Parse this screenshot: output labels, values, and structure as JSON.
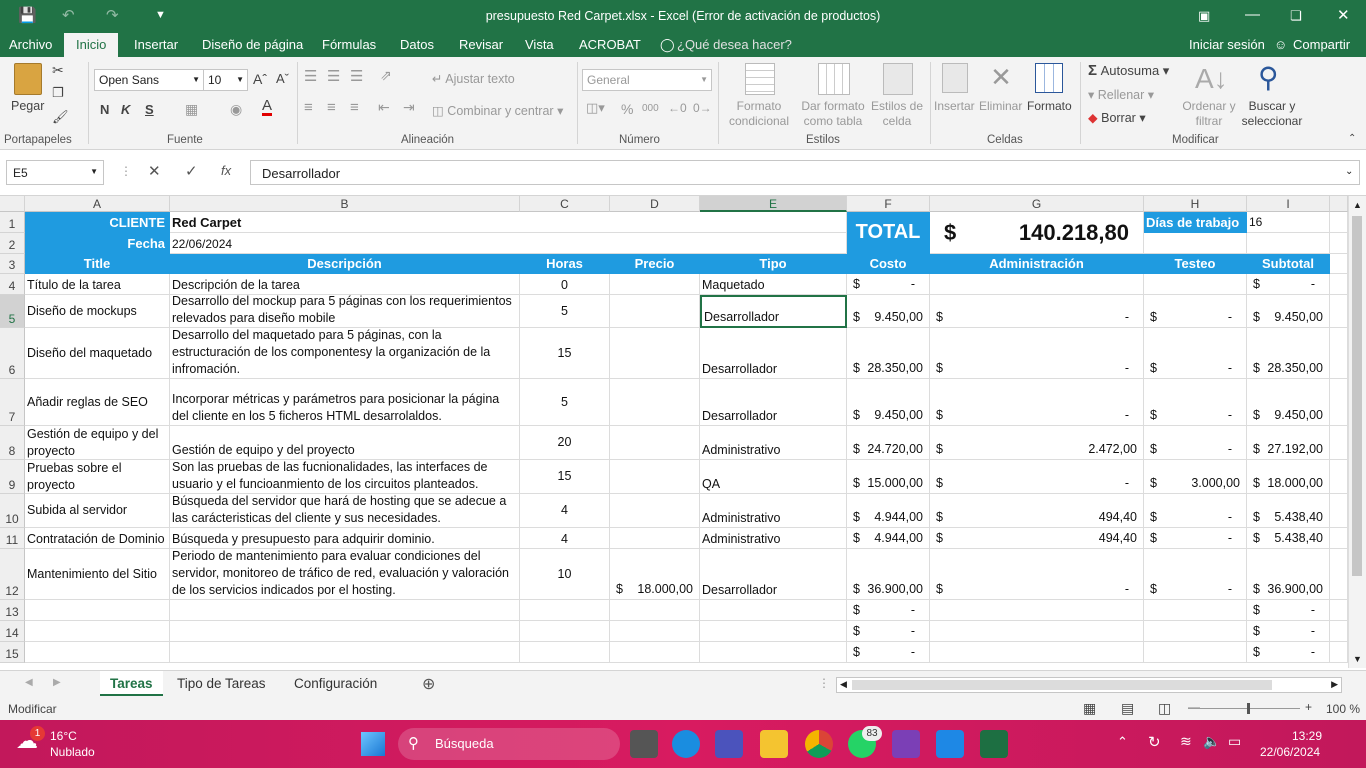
{
  "window": {
    "title": "presupuesto Red Carpet.xlsx - Excel (Error de activación de productos)"
  },
  "menu": {
    "file": "Archivo",
    "tabs": [
      "Inicio",
      "Insertar",
      "Diseño de página",
      "Fórmulas",
      "Datos",
      "Revisar",
      "Vista",
      "ACROBAT"
    ],
    "help": "¿Qué desea hacer?",
    "signin": "Iniciar sesión",
    "share": "Compartir"
  },
  "ribbon": {
    "paste": "Pegar",
    "clipboard": "Portapapeles",
    "font_name": "Open Sans",
    "font_size": "10",
    "font_group": "Fuente",
    "bold": "N",
    "italic": "K",
    "underline": "S",
    "wrap": "Ajustar texto",
    "merge": "Combinar y centrar",
    "align_group": "Alineación",
    "number_format": "General",
    "number_group": "Número",
    "percent": "%",
    "thousands": "000",
    "cond_format": "Formato condicional",
    "as_table": "Dar formato como tabla",
    "cell_styles": "Estilos de celda",
    "styles_group": "Estilos",
    "insert": "Insertar",
    "delete": "Eliminar",
    "format": "Formato",
    "cells_group": "Celdas",
    "autosum": "Autosuma",
    "fill": "Rellenar",
    "clear": "Borrar",
    "sort": "Ordenar y filtrar",
    "find": "Buscar y seleccionar",
    "modify_group": "Modificar"
  },
  "formula_bar": {
    "name_box": "E5",
    "fx": "fx",
    "content": "Desarrollador"
  },
  "columns": [
    "A",
    "B",
    "C",
    "D",
    "E",
    "F",
    "G",
    "H",
    "I"
  ],
  "header": {
    "cliente_label": "CLIENTE",
    "cliente_value": "Red Carpet",
    "fecha_label": "Fecha",
    "fecha_value": "22/06/2024",
    "total_label": "TOTAL",
    "total_currency": "$",
    "total_value": "140.218,80",
    "dias_label": "Días de trabajo",
    "dias_value": "16"
  },
  "table_headers": [
    "Title",
    "Descripción",
    "Horas",
    "Precio",
    "Tipo",
    "Costo",
    "Administración",
    "Testeo",
    "Subtotal"
  ],
  "rows": [
    {
      "n": "4",
      "title": "Título de la tarea",
      "desc": "Descripción de la tarea",
      "horas": "0",
      "precio": "",
      "tipo": "Maquetado",
      "costo": "-",
      "admin": "",
      "testeo": "",
      "subtotal": "-"
    },
    {
      "n": "5",
      "title": "Diseño de mockups",
      "desc": "Desarrollo del mockup para 5 páginas con los requerimientos relevados para diseño mobile",
      "horas": "5",
      "precio": "",
      "tipo": "Desarrollador",
      "costo": "9.450,00",
      "admin": "-",
      "testeo": "-",
      "subtotal": "9.450,00"
    },
    {
      "n": "6",
      "title": "Diseño del maquetado",
      "desc": "Desarrollo del maquetado para 5 páginas, con la estructuración de los componentesy la organización de la infromación.",
      "horas": "15",
      "precio": "",
      "tipo": "Desarrollador",
      "costo": "28.350,00",
      "admin": "-",
      "testeo": "-",
      "subtotal": "28.350,00"
    },
    {
      "n": "7",
      "title": "Añadir reglas de SEO",
      "desc": "Incorporar métricas y parámetros para posicionar la página del cliente en los 5 ficheros HTML desarrolaldos.",
      "horas": "5",
      "precio": "",
      "tipo": "Desarrollador",
      "costo": "9.450,00",
      "admin": "-",
      "testeo": "-",
      "subtotal": "9.450,00"
    },
    {
      "n": "8",
      "title": "Gestión de equipo y del proyecto",
      "desc": "Gestión de equipo y del proyecto",
      "horas": "20",
      "precio": "",
      "tipo": "Administrativo",
      "costo": "24.720,00",
      "admin": "2.472,00",
      "testeo": "-",
      "subtotal": "27.192,00"
    },
    {
      "n": "9",
      "title": "Pruebas sobre el proyecto",
      "desc": "Son las pruebas de las fucnionalidades, las interfaces de usuario y el funcioanmiento de los circuitos planteados.",
      "horas": "15",
      "precio": "",
      "tipo": "QA",
      "costo": "15.000,00",
      "admin": "-",
      "testeo": "3.000,00",
      "subtotal": "18.000,00"
    },
    {
      "n": "10",
      "title": "Subida al servidor",
      "desc": "Búsqueda del servidor que hará de hosting que se adecue a las carácteristicas del cliente y sus necesidades.",
      "horas": "4",
      "precio": "",
      "tipo": "Administrativo",
      "costo": "4.944,00",
      "admin": "494,40",
      "testeo": "-",
      "subtotal": "5.438,40"
    },
    {
      "n": "11",
      "title": "Contratación de Dominio",
      "desc": "Búsqueda y presupuesto para adquirir dominio.",
      "horas": "4",
      "precio": "",
      "tipo": "Administrativo",
      "costo": "4.944,00",
      "admin": "494,40",
      "testeo": "-",
      "subtotal": "5.438,40"
    },
    {
      "n": "12",
      "title": "Mantenimiento del Sitio",
      "desc": "Periodo de mantenimiento para evaluar condiciones del servidor, monitoreo de tráfico de red, evaluación y valoración de los servicios indicados por el hosting.",
      "horas": "10",
      "precio": "18.000,00",
      "tipo": "Desarrollador",
      "costo": "36.900,00",
      "admin": "-",
      "testeo": "-",
      "subtotal": "36.900,00"
    },
    {
      "n": "13",
      "title": "",
      "desc": "",
      "horas": "",
      "precio": "",
      "tipo": "",
      "costo": "-",
      "admin": "",
      "testeo": "",
      "subtotal": "-"
    },
    {
      "n": "14",
      "title": "",
      "desc": "",
      "horas": "",
      "precio": "",
      "tipo": "",
      "costo": "-",
      "admin": "",
      "testeo": "",
      "subtotal": "-"
    },
    {
      "n": "15",
      "title": "",
      "desc": "",
      "horas": "",
      "precio": "",
      "tipo": "",
      "costo": "-",
      "admin": "",
      "testeo": "",
      "subtotal": "-"
    }
  ],
  "row_header_labels": [
    "1",
    "2",
    "3"
  ],
  "currency": "$",
  "sheets": [
    "Tareas",
    "Tipo de Tareas",
    "Configuración"
  ],
  "status": {
    "mode": "Modificar",
    "zoom": "100 %"
  },
  "taskbar": {
    "weather_temp": "16°C",
    "weather_desc": "Nublado",
    "weather_badge": "1",
    "search": "Búsqueda",
    "whatsapp_badge": "83",
    "time": "13:29",
    "date": "22/06/2024"
  },
  "colors": {
    "excel_green": "#217346",
    "header_blue": "#1f9be0",
    "taskbar": "#d81b60"
  }
}
